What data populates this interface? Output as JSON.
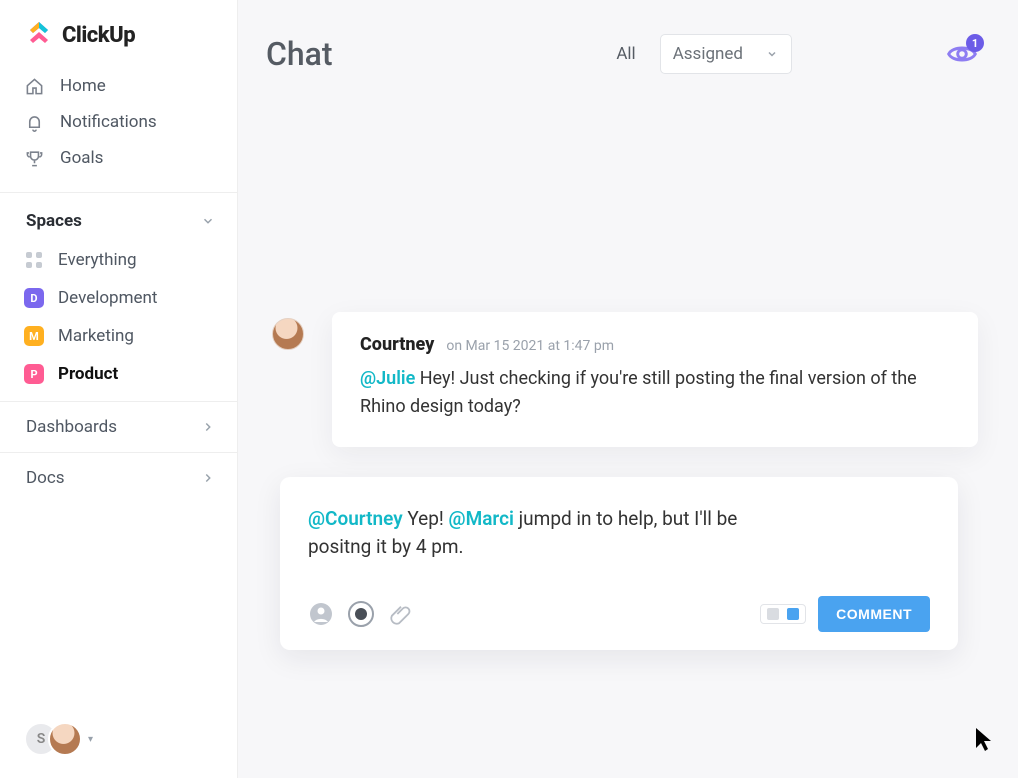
{
  "brand": {
    "name": "ClickUp"
  },
  "sidebar": {
    "nav": [
      {
        "label": "Home",
        "icon": "home-icon"
      },
      {
        "label": "Notifications",
        "icon": "bell-icon"
      },
      {
        "label": "Goals",
        "icon": "trophy-icon"
      }
    ],
    "spaces_header": "Spaces",
    "spaces": [
      {
        "label": "Everything",
        "icon": "dots-grid-icon",
        "color": ""
      },
      {
        "label": "Development",
        "icon_letter": "D",
        "color": "#7b68ee"
      },
      {
        "label": "Marketing",
        "icon_letter": "M",
        "color": "#ffb020"
      },
      {
        "label": "Product",
        "icon_letter": "P",
        "color": "#ff5c93",
        "active": true
      }
    ],
    "sections": [
      {
        "label": "Dashboards"
      },
      {
        "label": "Docs"
      }
    ],
    "footer": {
      "initial": "S"
    }
  },
  "header": {
    "title": "Chat",
    "filter_all": "All",
    "assigned_label": "Assigned",
    "watch_count": "1"
  },
  "message": {
    "author": "Courtney",
    "timestamp": "on Mar 15 2021 at 1:47 pm",
    "mention": "@Julie",
    "body_rest": " Hey! Just checking if you're still posting the final version of the Rhino design today?"
  },
  "compose": {
    "mention1": "@Courtney",
    "text1": " Yep! ",
    "mention2": "@Marci",
    "text2": " jumpd in to help, but I'll be positng it by 4 pm.",
    "button_label": "COMMENT"
  }
}
